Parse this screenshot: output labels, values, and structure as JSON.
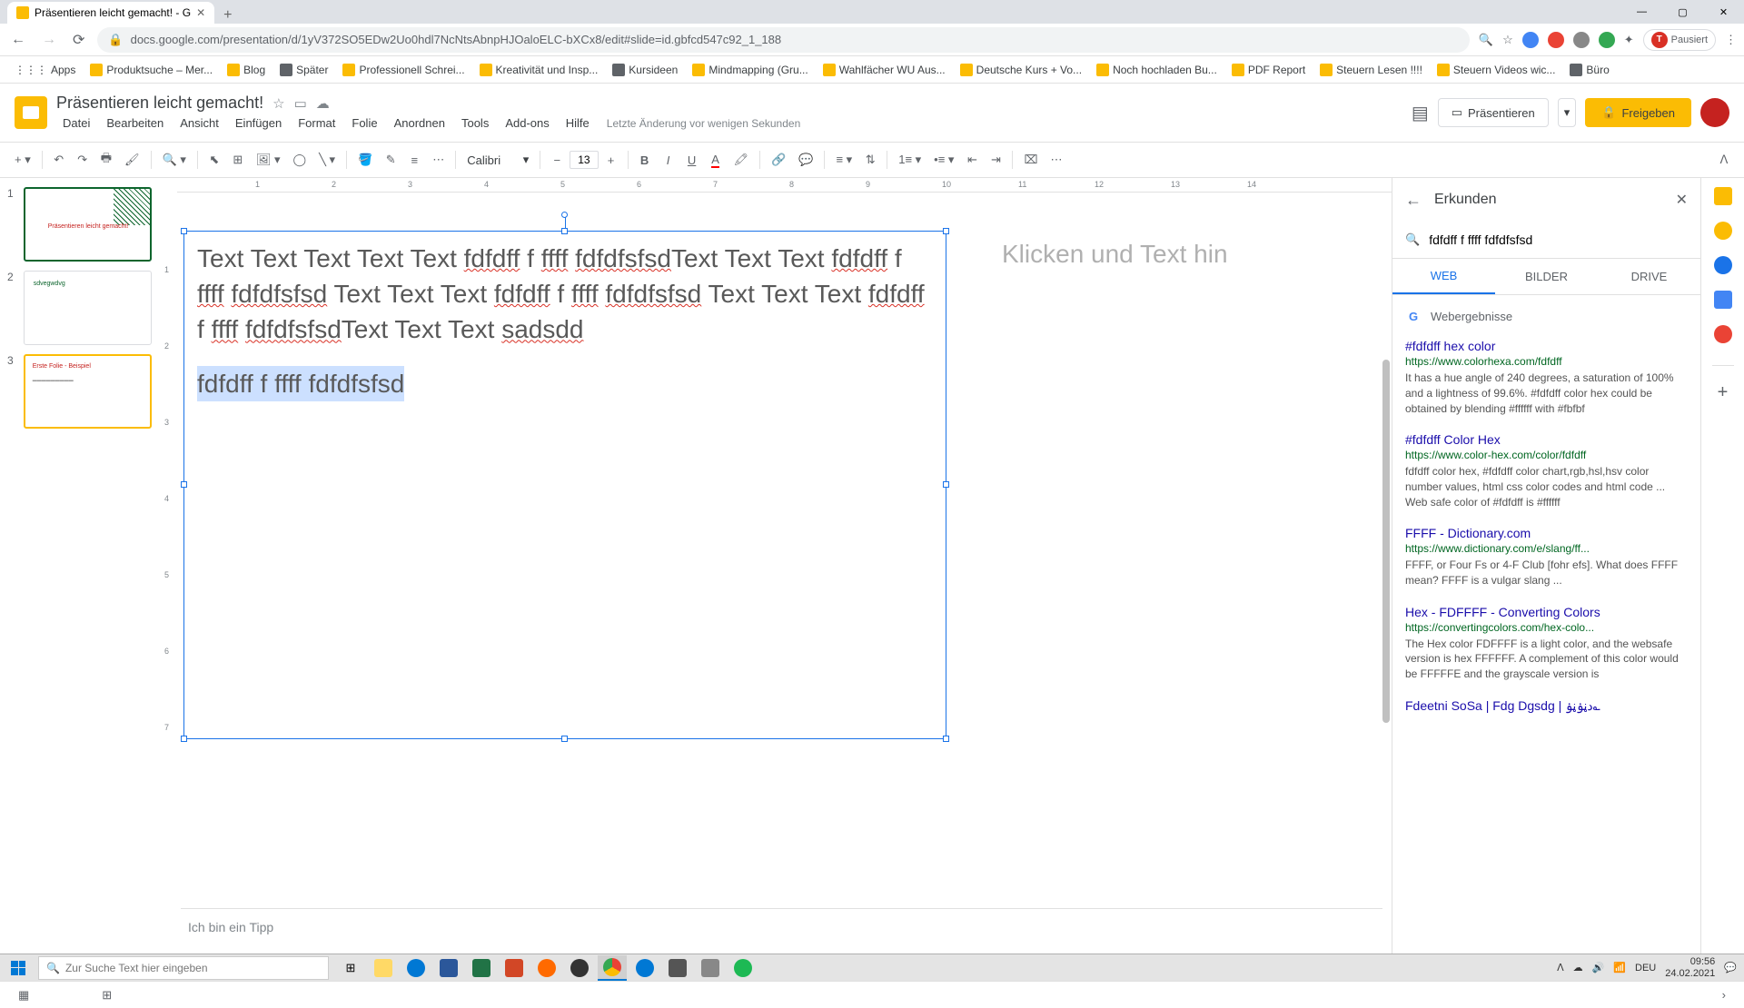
{
  "browser": {
    "tab_title": "Präsentieren leicht gemacht! - G",
    "url": "docs.google.com/presentation/d/1yV372SO5EDw2Uo0hdl7NcNtsAbnpHJOaloELC-bXCx8/edit#slide=id.gbfcd547c92_1_188",
    "pause": "Pausiert"
  },
  "bookmarks": {
    "apps": "Apps",
    "items": [
      "Produktsuche – Mer...",
      "Blog",
      "Später",
      "Professionell Schrei...",
      "Kreativität und Insp...",
      "Kursideen",
      "Mindmapping  (Gru...",
      "Wahlfächer WU Aus...",
      "Deutsche Kurs + Vo...",
      "Noch hochladen Bu...",
      "PDF Report",
      "Steuern Lesen !!!!",
      "Steuern Videos wic...",
      "Büro"
    ]
  },
  "doc": {
    "title": "Präsentieren leicht gemacht!",
    "menus": [
      "Datei",
      "Bearbeiten",
      "Ansicht",
      "Einfügen",
      "Format",
      "Folie",
      "Anordnen",
      "Tools",
      "Add-ons",
      "Hilfe"
    ],
    "last_edit": "Letzte Änderung vor wenigen Sekunden",
    "present": "Präsentieren",
    "share": "Freigeben"
  },
  "toolbar": {
    "font": "Calibri",
    "font_size": "13"
  },
  "ruler": {
    "h": [
      "1",
      "2",
      "3",
      "4",
      "5",
      "6",
      "7",
      "8",
      "9",
      "10",
      "11",
      "12",
      "13",
      "14"
    ],
    "v": [
      "1",
      "2",
      "3",
      "4",
      "5",
      "6",
      "7"
    ]
  },
  "slide": {
    "text_main": "Text Text Text Text Text fdfdff f ffff fdfdfsfsdText Text Text fdfdff f ffff fdfdfsfsd Text Text Text fdfdff f ffff fdfdfsfsd Text Text Text fdfdff f ffff fdfdfsfsdText Text Text sadsdd",
    "text_selected": "fdfdff f ffff fdfdfsfsd",
    "notes_placeholder": "Klicken und Text hin",
    "speaker_notes": "Ich bin ein Tipp"
  },
  "thumbs": {
    "t1": "Präsentieren leicht gemacht!",
    "t2": "sdvegwdvg",
    "t3_title": "Erste Folie - Beispiel"
  },
  "explore": {
    "title": "Erkunden",
    "search_value": "fdfdff f ffff fdfdfsfsd",
    "tabs": {
      "web": "WEB",
      "images": "BILDER",
      "drive": "DRIVE"
    },
    "results_header": "Webergebnisse",
    "results": [
      {
        "title": "#fdfdff hex color",
        "url": "https://www.colorhexa.com/fdfdff",
        "desc": "It has a hue angle of 240 degrees, a saturation of 100% and a lightness of 99.6%. #fdfdff color hex could be obtained by blending #ffffff with #fbfbf"
      },
      {
        "title": "#fdfdff Color Hex",
        "url": "https://www.color-hex.com/color/fdfdff",
        "desc": "fdfdff color hex, #fdfdff color chart,rgb,hsl,hsv color number values, html css color codes and html code ... Web safe color of #fdfdff is #ffffff"
      },
      {
        "title": "FFFF - Dictionary.com",
        "url": "https://www.dictionary.com/e/slang/ff...",
        "desc": "FFFF, or Four Fs or 4-F Club [fohr efs]. What does FFFF mean? FFFF is a vulgar slang ..."
      },
      {
        "title": "Hex - FDFFFF - Converting Colors",
        "url": "https://convertingcolors.com/hex-colo...",
        "desc": "The Hex color FDFFFF is a light color, and the websafe version is hex FFFFFF. A complement of this color would be FFFFFE and the grayscale version is"
      },
      {
        "title": "Fdeetni SoSa | Fdg Dgsdg | دڼۏڼۏ؎",
        "url": "",
        "desc": ""
      }
    ]
  },
  "taskbar": {
    "search_placeholder": "Zur Suche Text hier eingeben",
    "lang": "DEU",
    "time": "09:56",
    "date": "24.02.2021"
  }
}
